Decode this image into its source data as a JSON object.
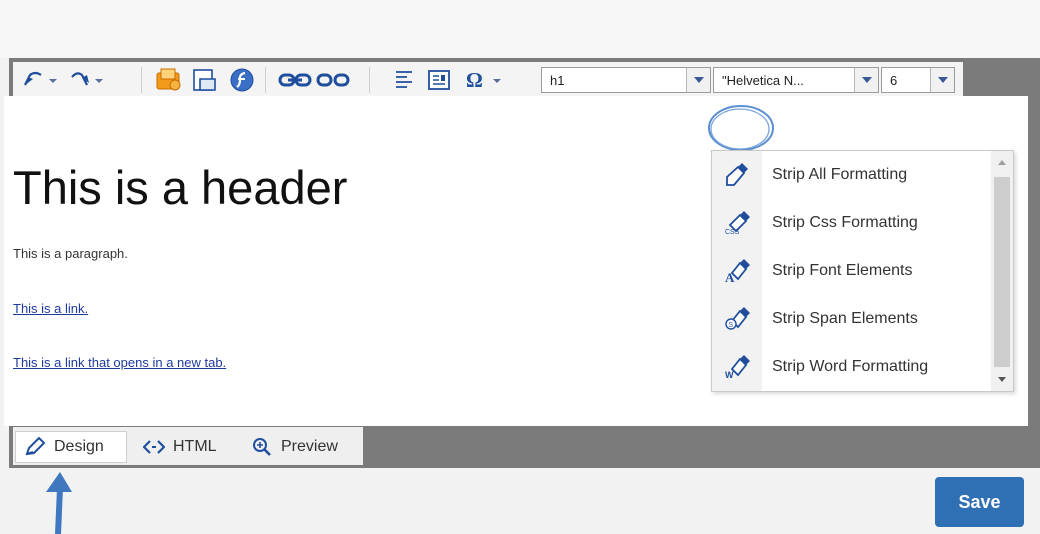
{
  "toolbar": {
    "paragraph_style": "h1",
    "font_family": "\"Helvetica N...",
    "font_size": "6"
  },
  "content": {
    "header": "This is a header",
    "paragraph": "This is a paragraph.",
    "link1": "This is a link.",
    "link2": "This is a link that opens in a new tab."
  },
  "strip_menu": {
    "items": [
      {
        "label": "Strip All Formatting",
        "icon": "strip-all-icon"
      },
      {
        "label": "Strip Css Formatting",
        "icon": "strip-css-icon"
      },
      {
        "label": "Strip Font Elements",
        "icon": "strip-font-icon"
      },
      {
        "label": "Strip Span Elements",
        "icon": "strip-span-icon"
      },
      {
        "label": "Strip Word Formatting",
        "icon": "strip-word-icon"
      }
    ]
  },
  "modes": {
    "design": "Design",
    "html": "HTML",
    "preview": "Preview"
  },
  "actions": {
    "save": "Save"
  },
  "colors": {
    "accent_blue": "#2f6fb4",
    "toolbar_bg": "#f4f4f4",
    "frame_gray": "#7b7b7b",
    "link": "#1e3a9e"
  }
}
